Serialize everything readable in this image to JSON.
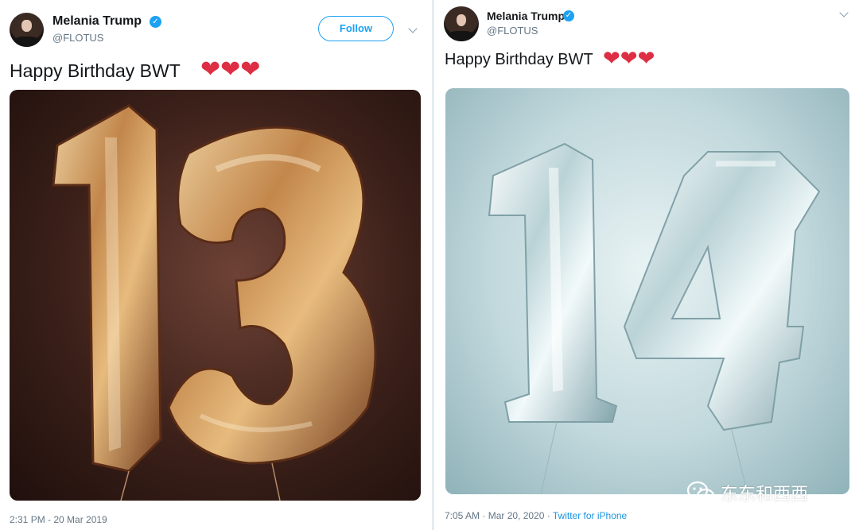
{
  "tweets": [
    {
      "display_name": "Melania Trump",
      "handle": "@FLOTUS",
      "verified": true,
      "follow_label": "Follow",
      "text": "Happy Birthday BWT",
      "hearts": [
        "❤",
        "❤",
        "❤"
      ],
      "media_icon": "gold-balloons-13",
      "timestamp": "2:31 PM - 20 Mar 2019"
    },
    {
      "display_name": "Melania Trump",
      "handle": "@FLOTUS",
      "verified": true,
      "text": "Happy Birthday BWT",
      "hearts": [
        "❤",
        "❤",
        "❤"
      ],
      "media_icon": "silver-balloons-14",
      "timestamp": "7:05 AM · Mar 20, 2020 · ",
      "source": "Twitter for iPhone"
    }
  ],
  "watermark": {
    "text": "东东和西西",
    "icon": "wechat-icon"
  },
  "colors": {
    "accent": "#1da1f2",
    "heart": "#dd2e44",
    "gold": "#d9a468",
    "silver": "#e8f2f4"
  }
}
